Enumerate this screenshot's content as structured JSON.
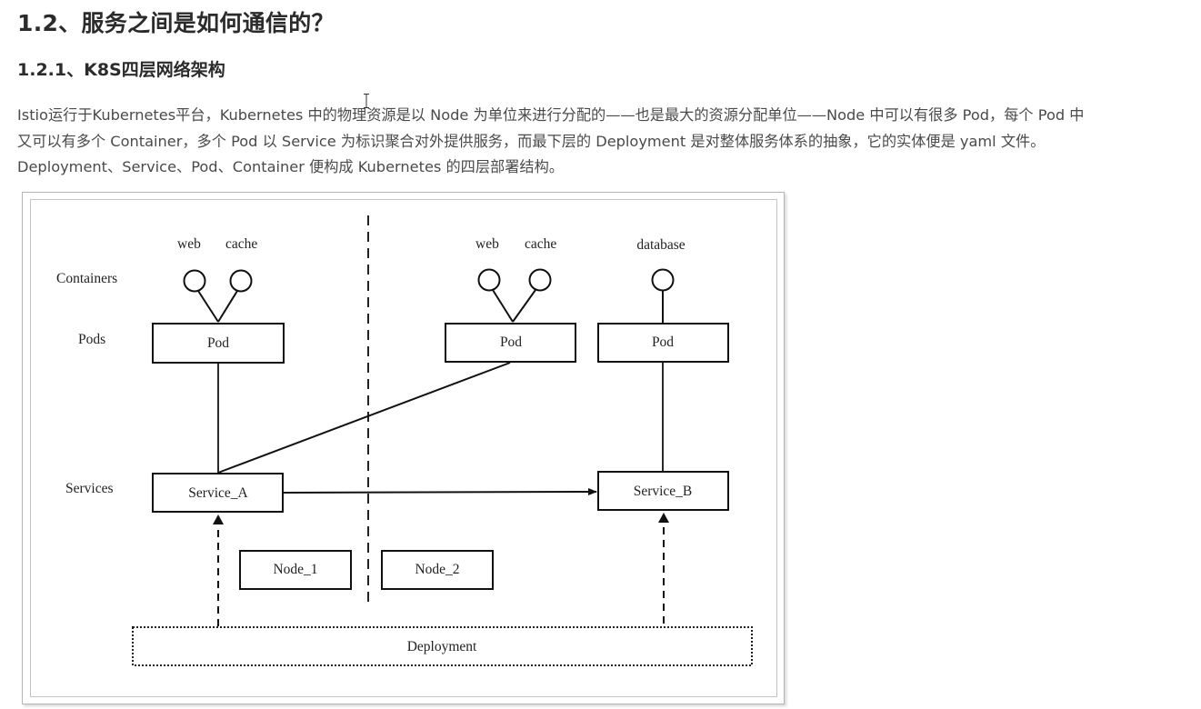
{
  "heading": "1.2、服务之间是如何通信的？",
  "subheading": "1.2.1、K8S四层网络架构",
  "paragraph": {
    "lines": [
      "Istio运行于Kubernetes平台，Kubernetes 中的物理资源是以 Node 为单位来进行分配的——也是最大的资源分配单位——Node 中可以有很多 Pod，每个 Pod 中",
      "又可以有多个 Container，多个 Pod 以 Service 为标识聚合对外提供服务，而最下层的 Deployment 是对整体服务体系的抽象，它的实体便是 yaml 文件。",
      "Deployment、Service、Pod、Container 便构成 Kubernetes 的四层部署结构。"
    ]
  },
  "diagram": {
    "row_labels": {
      "containers": "Containers",
      "pods": "Pods",
      "services": "Services"
    },
    "node1": {
      "container_labels": [
        "web",
        "cache"
      ],
      "pod_label": "Pod",
      "service_label": "Service_A",
      "node_label": "Node_1"
    },
    "node2": {
      "pod1": {
        "container_labels": [
          "web",
          "cache"
        ],
        "pod_label": "Pod"
      },
      "pod2": {
        "container_labels": [
          "database"
        ],
        "pod_label": "Pod"
      },
      "service_label": "Service_B",
      "node_label": "Node_2"
    },
    "deployment_label": "Deployment"
  }
}
